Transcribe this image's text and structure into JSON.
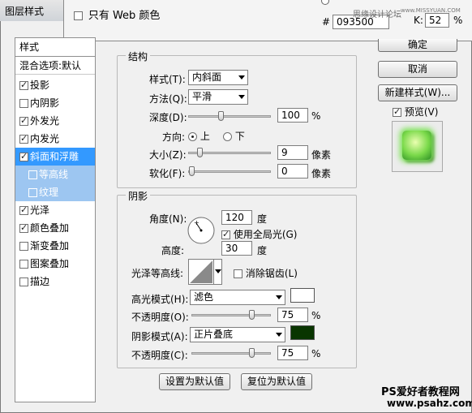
{
  "window": {
    "title": "图层样式"
  },
  "color_picker": {
    "web_only_label": "只有 Web 颜色",
    "hash": "#",
    "hex_value": "093500",
    "k_label": "K:",
    "k_value": "52",
    "percent": "%"
  },
  "watermark_top": "思缘设计论坛",
  "watermark_top_url": "www.MISSYUAN.COM",
  "styles_list": {
    "header": "样式",
    "blend": "混合选项:默认",
    "items": [
      {
        "label": "投影",
        "checked": true
      },
      {
        "label": "内阴影",
        "checked": false
      },
      {
        "label": "外发光",
        "checked": true
      },
      {
        "label": "内发光",
        "checked": true
      },
      {
        "label": "斜面和浮雕",
        "checked": true
      },
      {
        "label": "等高线",
        "checked": false
      },
      {
        "label": "纹理",
        "checked": false
      },
      {
        "label": "光泽",
        "checked": true
      },
      {
        "label": "颜色叠加",
        "checked": true
      },
      {
        "label": "渐变叠加",
        "checked": false
      },
      {
        "label": "图案叠加",
        "checked": false
      },
      {
        "label": "描边",
        "checked": false
      }
    ]
  },
  "structure": {
    "title": "结构",
    "style_label": "样式(T):",
    "style_value": "内斜面",
    "technique_label": "方法(Q):",
    "technique_value": "平滑",
    "depth_label": "深度(D):",
    "depth_value": "100",
    "depth_unit": "%",
    "direction_label": "方向:",
    "dir_up": "上",
    "dir_down": "下",
    "size_label": "大小(Z):",
    "size_value": "9",
    "size_unit": "像素",
    "soften_label": "软化(F):",
    "soften_value": "0",
    "soften_unit": "像素"
  },
  "shading": {
    "title": "阴影",
    "angle_label": "角度(N):",
    "angle_value": "120",
    "angle_unit": "度",
    "global_light_label": "使用全局光(G)",
    "altitude_label": "高度:",
    "altitude_value": "30",
    "altitude_unit": "度",
    "gloss_label": "光泽等高线:",
    "antialias_label": "消除锯齿(L)",
    "highlight_mode_label": "高光模式(H):",
    "highlight_mode_value": "滤色",
    "highlight_color": "#ffffff",
    "highlight_opacity_label": "不透明度(O):",
    "highlight_opacity_value": "75",
    "shadow_mode_label": "阴影模式(A):",
    "shadow_mode_value": "正片叠底",
    "shadow_color": "#093500",
    "shadow_opacity_label": "不透明度(C):",
    "shadow_opacity_value": "75",
    "percent": "%"
  },
  "buttons": {
    "ok": "确定",
    "cancel": "取消",
    "new_style": "新建样式(W)...",
    "preview": "预览(V)",
    "set_default": "设置为默认值",
    "reset_default": "复位为默认值"
  },
  "watermark_bottom": {
    "line1": "PS爱好者教程网",
    "line2": "www.psahz.com"
  }
}
